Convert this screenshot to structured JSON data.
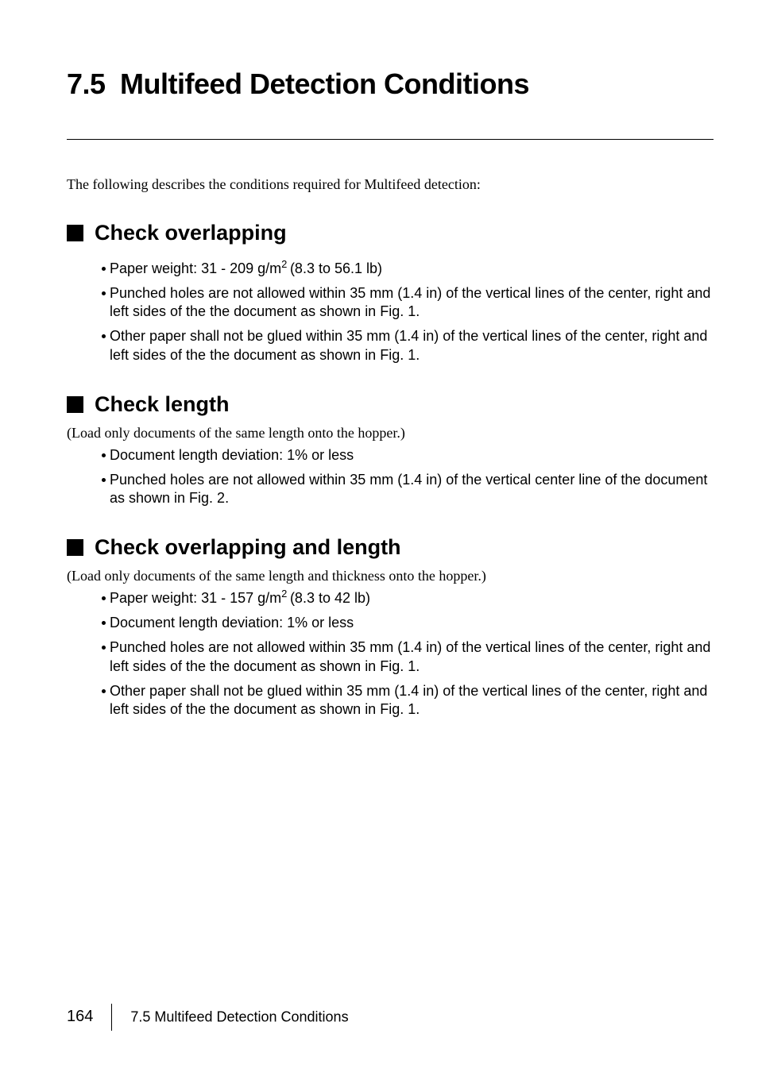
{
  "section": {
    "number": "7.5",
    "title": "Multifeed Detection Conditions"
  },
  "intro": "The following describes the conditions required for Multifeed detection:",
  "sub1": {
    "heading": "Check overlapping",
    "items": [
      {
        "pre": "Paper weight: 31 - 209 g/m",
        "sup": "2 ",
        "post": "(8.3 to 56.1 lb)"
      },
      {
        "text": "Punched holes are not allowed within 35 mm (1.4 in) of the vertical lines of the center, right and left sides of the the document as shown in Fig. 1."
      },
      {
        "text": "Other paper shall not be glued within 35 mm (1.4 in) of the vertical lines of the center, right and left sides of the the document as shown in Fig. 1."
      }
    ]
  },
  "sub2": {
    "heading": "Check length",
    "note": "(Load only documents of the same length onto the hopper.)",
    "items": [
      {
        "text": "Document length deviation: 1% or less"
      },
      {
        "text": "Punched holes are not allowed within 35 mm (1.4 in) of the vertical center line of the document as shown in Fig. 2."
      }
    ]
  },
  "sub3": {
    "heading": "Check overlapping and length",
    "note": "(Load only documents of the same length and thickness onto the hopper.)",
    "items": [
      {
        "pre": "Paper weight: 31 - 157 g/m",
        "sup": "2 ",
        "post": "(8.3 to 42 lb)"
      },
      {
        "text": "Document length deviation: 1% or less"
      },
      {
        "text": "Punched holes are not allowed within 35 mm (1.4 in) of the vertical lines of the center, right and left sides of the the document as shown in Fig. 1."
      },
      {
        "text": "Other paper shall not be glued within 35 mm (1.4 in) of the vertical lines of the center, right and left sides of the the document as shown in Fig. 1."
      }
    ]
  },
  "footer": {
    "page": "164",
    "text": "7.5 Multifeed Detection Conditions"
  }
}
